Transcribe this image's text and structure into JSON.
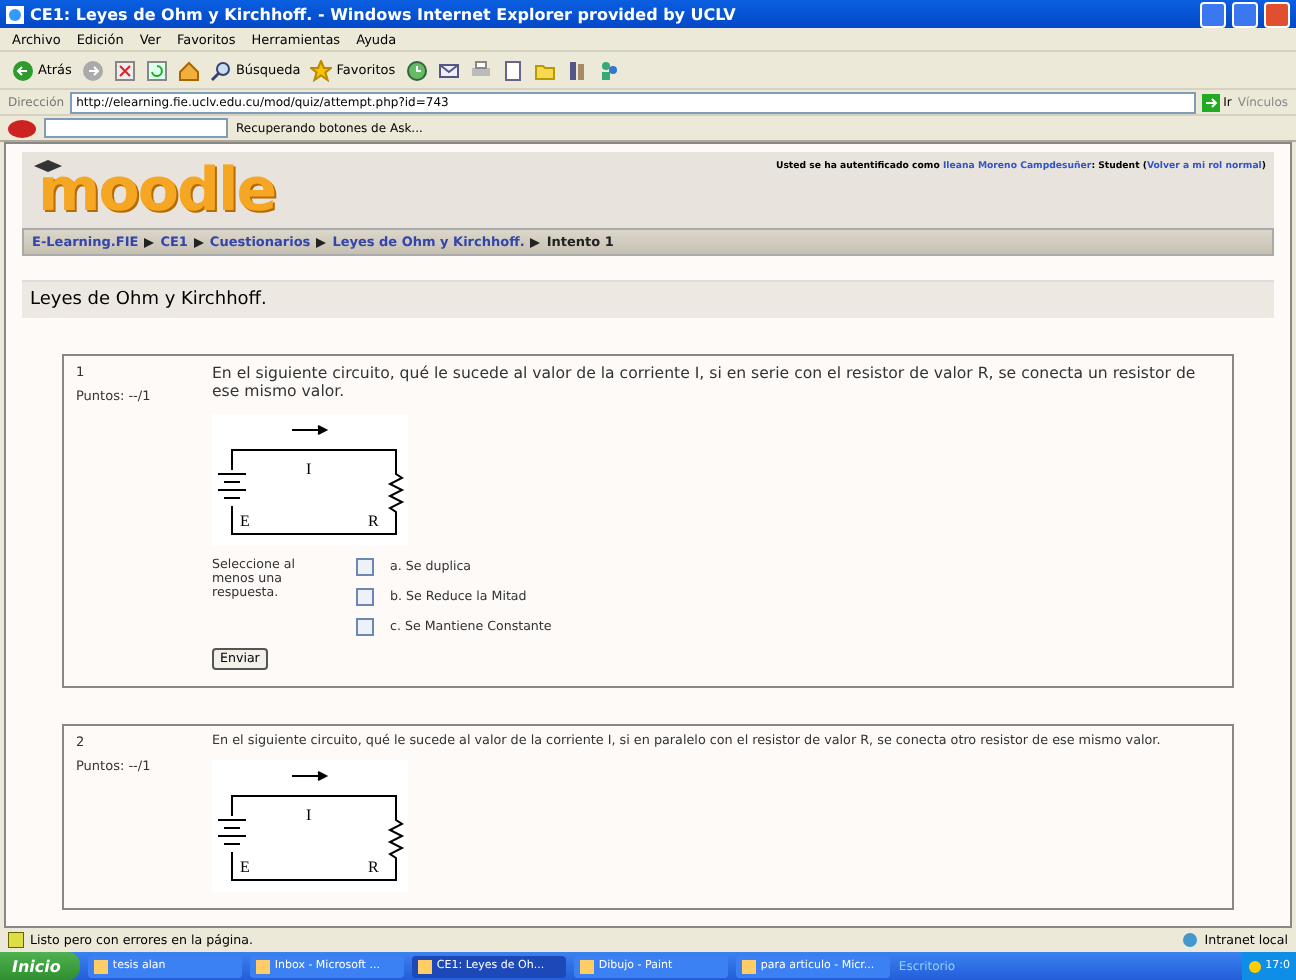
{
  "window": {
    "title": "CE1: Leyes de Ohm y Kirchhoff. - Windows Internet Explorer provided by UCLV"
  },
  "menu": [
    "Archivo",
    "Edición",
    "Ver",
    "Favoritos",
    "Herramientas",
    "Ayuda"
  ],
  "toolbar": [
    {
      "kind": "back",
      "label": "Atrás"
    },
    {
      "kind": "forward"
    },
    {
      "kind": "stop"
    },
    {
      "kind": "refresh"
    },
    {
      "kind": "home"
    },
    {
      "kind": "search",
      "label": "Búsqueda"
    },
    {
      "kind": "favorites",
      "label": "Favoritos"
    },
    {
      "kind": "history"
    },
    {
      "kind": "mail"
    },
    {
      "kind": "print"
    },
    {
      "kind": "edit"
    },
    {
      "kind": "folder"
    },
    {
      "kind": "research"
    },
    {
      "kind": "messenger"
    }
  ],
  "address": {
    "label": "Dirección",
    "url": "http://elearning.fie.uclv.edu.cu/mod/quiz/attempt.php?id=743",
    "go": "Ir",
    "links": "Vínculos"
  },
  "askbar": {
    "status": "Recuperando botones de Ask..."
  },
  "header": {
    "logo": "moodle",
    "login_prefix": "Usted se ha autentificado como ",
    "user": "Ileana Moreno Campdesuñer",
    "login_middle": ": Student (",
    "return_link": "Volver a mi rol normal",
    "login_suffix": ")"
  },
  "breadcrumb": [
    {
      "label": "E-Learning.FIE",
      "link": true
    },
    {
      "label": "CE1",
      "link": true
    },
    {
      "label": "Cuestionarios",
      "link": true
    },
    {
      "label": "Leyes de Ohm y Kirchhoff.",
      "link": true
    },
    {
      "label": "Intento 1",
      "link": false
    }
  ],
  "heading": "Leyes de Ohm y Kirchhoff.",
  "questions": [
    {
      "number": "1",
      "points": "Puntos: --/1",
      "text": "En el siguiente circuito, qué le sucede al valor de la corriente I, si en serie con el resistor de valor R, se conecta un resistor de ese mismo valor.",
      "circuit": {
        "current": "I",
        "source": "E",
        "resistor": "R"
      },
      "instruction": "Seleccione al menos una respuesta.",
      "options": [
        {
          "label": "a. Se duplica",
          "checked": false
        },
        {
          "label": "b. Se Reduce la Mitad",
          "checked": false
        },
        {
          "label": "c. Se Mantiene Constante",
          "checked": false
        }
      ],
      "submit": "Enviar"
    },
    {
      "number": "2",
      "points": "Puntos: --/1",
      "text": "En el siguiente circuito, qué le sucede al valor de la corriente I, si en paralelo con el resistor de valor R, se conecta otro resistor de ese mismo valor.",
      "circuit": {
        "current": "I",
        "source": "E",
        "resistor": "R"
      }
    }
  ],
  "status_bar": {
    "message": "Listo pero con errores en la página.",
    "zone": "Intranet local"
  },
  "taskbar": {
    "start": "Inicio",
    "tasks": [
      {
        "label": "tesis alan",
        "selected": false
      },
      {
        "label": "Inbox - Microsoft ...",
        "selected": false
      },
      {
        "label": "CE1: Leyes de Oh...",
        "selected": true
      },
      {
        "label": "Dibujo - Paint",
        "selected": false
      },
      {
        "label": "para articulo - Micr...",
        "selected": false
      }
    ],
    "desktop": "Escritorio",
    "clock": "17:0"
  }
}
